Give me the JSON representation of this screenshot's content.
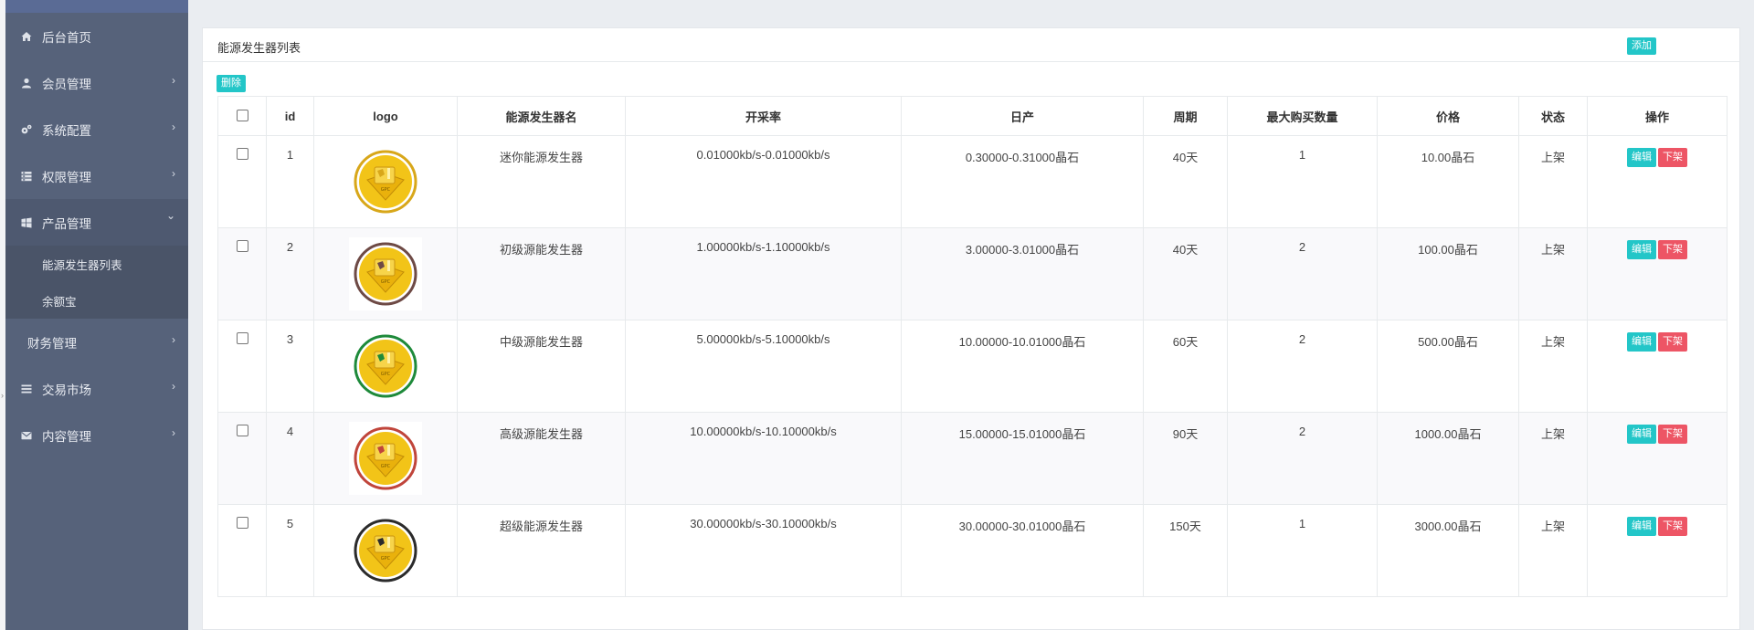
{
  "sidebar": {
    "items": [
      {
        "label": "后台首页",
        "icon": "home-icon",
        "chevron": ""
      },
      {
        "label": "会员管理",
        "icon": "user-icon",
        "chevron": "›"
      },
      {
        "label": "系统配置",
        "icon": "gears-icon",
        "chevron": "›"
      },
      {
        "label": "权限管理",
        "icon": "list-icon",
        "chevron": "›"
      },
      {
        "label": "产品管理",
        "icon": "windows-icon",
        "chevron": "⌄"
      },
      {
        "label": "财务管理",
        "icon": "",
        "chevron": "›"
      },
      {
        "label": "交易市场",
        "icon": "bars-icon",
        "chevron": "›"
      },
      {
        "label": "内容管理",
        "icon": "envelope-icon",
        "chevron": "›"
      }
    ],
    "submenu": [
      "能源发生器列表",
      "余额宝"
    ]
  },
  "panel": {
    "title": "能源发生器列表",
    "add_label": "添加",
    "delete_label": "删除"
  },
  "table": {
    "headers": [
      "id",
      "logo",
      "能源发生器名",
      "开采率",
      "日产",
      "周期",
      "最大购买数量",
      "价格",
      "状态",
      "操作"
    ],
    "edit_label": "编辑",
    "offshelf_label": "下架",
    "rows": [
      {
        "id": "1",
        "name": "迷你能源发生器",
        "rate": "0.01000kb/s-0.01000kb/s",
        "daily": "0.30000-0.31000晶石",
        "period": "40天",
        "max": "1",
        "price": "10.00晶石",
        "status": "上架",
        "ring": "#d8a71a"
      },
      {
        "id": "2",
        "name": "初级源能发生器",
        "rate": "1.00000kb/s-1.10000kb/s",
        "daily": "3.00000-3.01000晶石",
        "period": "40天",
        "max": "2",
        "price": "100.00晶石",
        "status": "上架",
        "ring": "#6e4a45"
      },
      {
        "id": "3",
        "name": "中级源能发生器",
        "rate": "5.00000kb/s-5.10000kb/s",
        "daily": "10.00000-10.01000晶石",
        "period": "60天",
        "max": "2",
        "price": "500.00晶石",
        "status": "上架",
        "ring": "#1e8a3a"
      },
      {
        "id": "4",
        "name": "高级源能发生器",
        "rate": "10.00000kb/s-10.10000kb/s",
        "daily": "15.00000-15.01000晶石",
        "period": "90天",
        "max": "2",
        "price": "1000.00晶石",
        "status": "上架",
        "ring": "#c0453b"
      },
      {
        "id": "5",
        "name": "超级能源发生器",
        "rate": "30.00000kb/s-30.10000kb/s",
        "daily": "30.00000-30.01000晶石",
        "period": "150天",
        "max": "1",
        "price": "3000.00晶石",
        "status": "上架",
        "ring": "#2b2b2b"
      }
    ]
  },
  "colors": {
    "teal": "#23c6c8",
    "red": "#ed5565",
    "sidebar": "#56627a"
  }
}
